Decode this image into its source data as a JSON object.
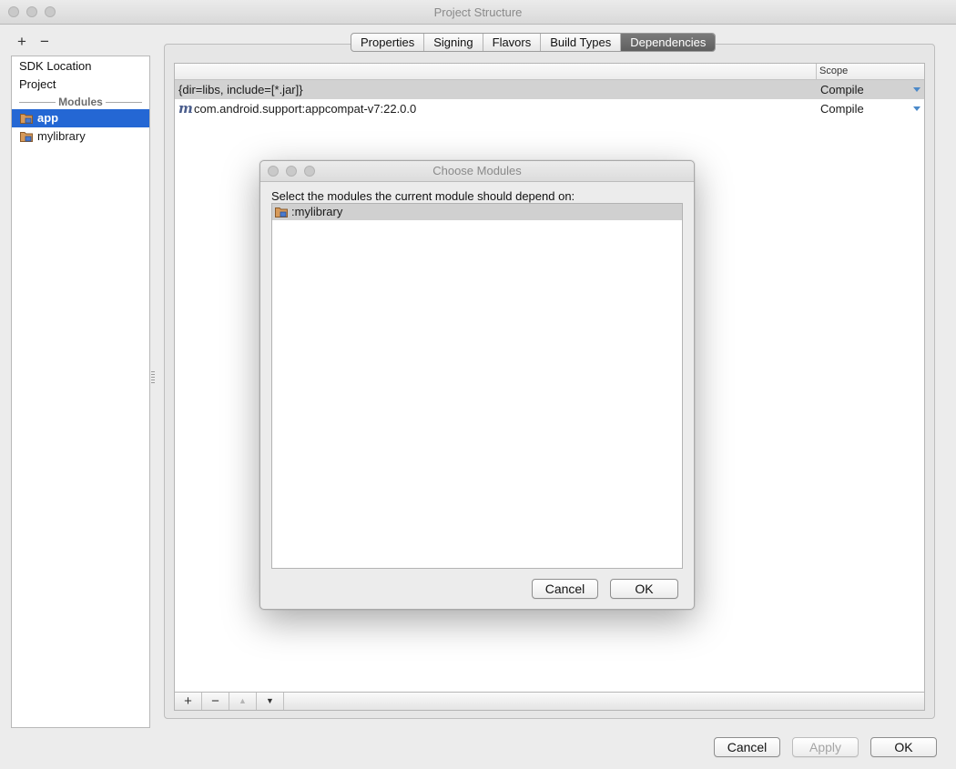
{
  "window": {
    "title": "Project Structure"
  },
  "left_panel": {
    "add_label": "+",
    "remove_label": "−",
    "items": [
      {
        "label": "SDK Location"
      },
      {
        "label": "Project"
      }
    ],
    "modules_header": "Modules",
    "modules": [
      {
        "label": "app",
        "selected": true,
        "icon": "module-folder-icon"
      },
      {
        "label": "mylibrary",
        "selected": false,
        "icon": "module-folder-icon"
      }
    ]
  },
  "tabs": [
    {
      "label": "Properties",
      "active": false
    },
    {
      "label": "Signing",
      "active": false
    },
    {
      "label": "Flavors",
      "active": false
    },
    {
      "label": "Build Types",
      "active": false
    },
    {
      "label": "Dependencies",
      "active": true
    }
  ],
  "dependencies": {
    "scope_header": "Scope",
    "rows": [
      {
        "name": "{dir=libs, include=[*.jar]}",
        "scope": "Compile",
        "selected": true,
        "icon": ""
      },
      {
        "name": "com.android.support:appcompat-v7:22.0.0",
        "scope": "Compile",
        "selected": false,
        "icon": "m"
      }
    ],
    "toolbar": {
      "add": "+",
      "remove": "−",
      "up": "▲",
      "down": "▼"
    }
  },
  "footer": {
    "cancel_label": "Cancel",
    "apply_label": "Apply",
    "ok_label": "OK"
  },
  "dialog": {
    "title": "Choose Modules",
    "prompt": "Select the modules the current module should depend on:",
    "items": [
      {
        "label": ":mylibrary"
      }
    ],
    "cancel_label": "Cancel",
    "ok_label": "OK"
  },
  "colors": {
    "selection_blue": "#2467d4",
    "active_tab": "#6a6a6a",
    "scope_arrow": "#4b89c9",
    "folder": "#c8874a"
  }
}
